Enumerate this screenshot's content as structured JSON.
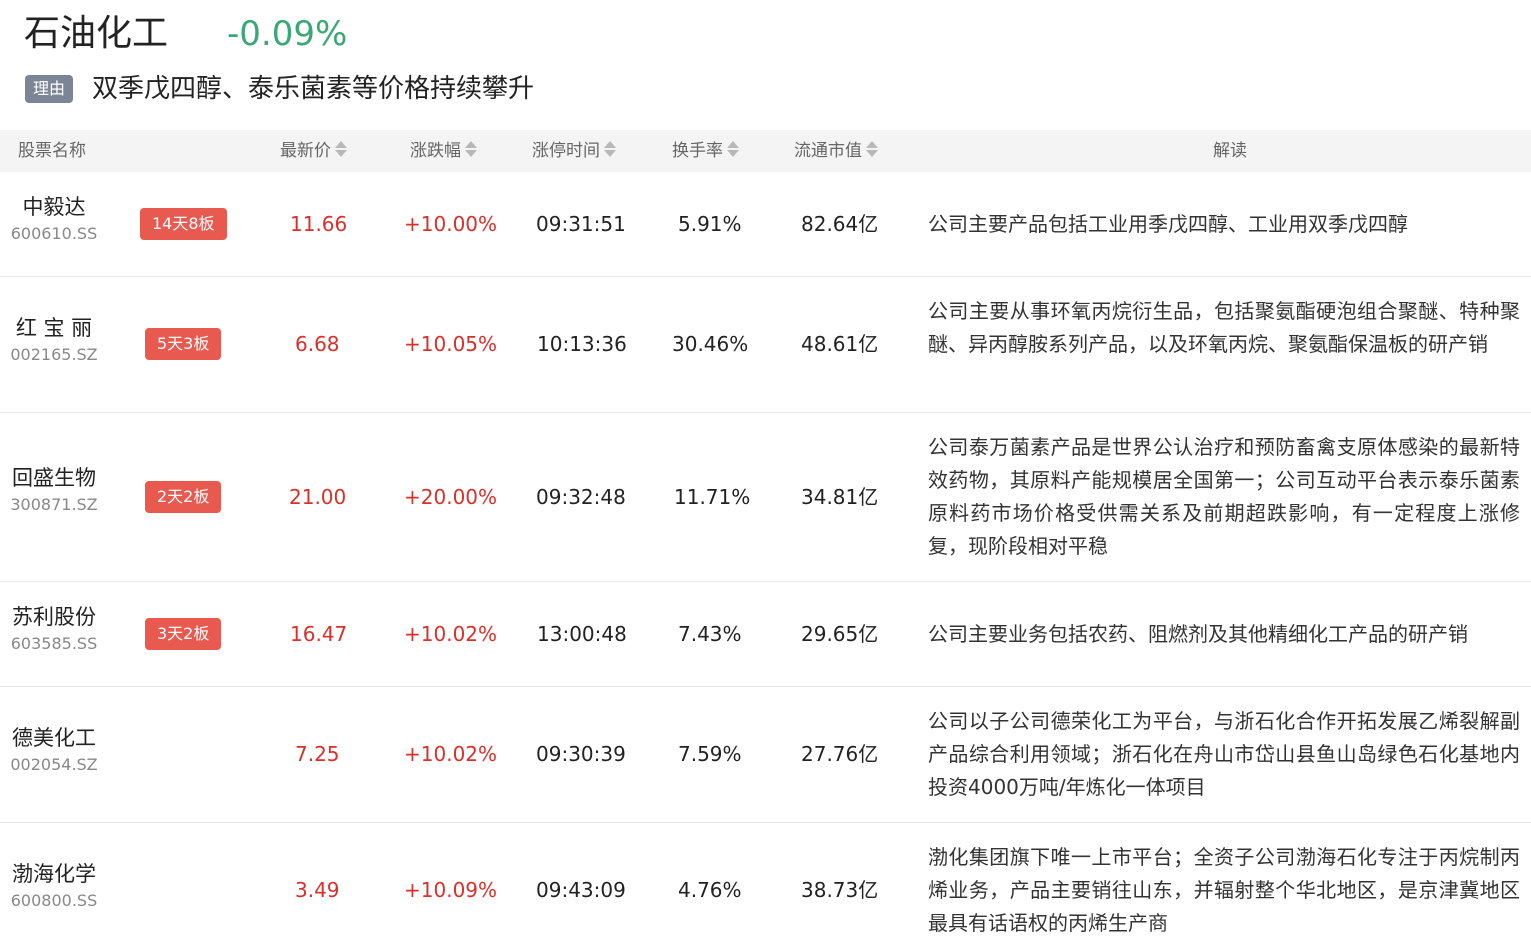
{
  "sector": {
    "name": "石油化工",
    "change": "-0.09%",
    "reason_label": "理由",
    "reason": "双季戊四醇、泰乐菌素等价格持续攀升"
  },
  "columns": {
    "name": "股票名称",
    "price": "最新价",
    "change": "涨跌幅",
    "limit_time": "涨停时间",
    "turnover": "换手率",
    "market_cap": "流通市值",
    "analysis": "解读"
  },
  "rows": [
    {
      "name": "中毅达",
      "code": "600610.SS",
      "tag": "14天8板",
      "price": "11.66",
      "change": "+10.00%",
      "time": "09:31:51",
      "turnover": "5.91%",
      "cap": "82.64亿",
      "desc": "公司主要产品包括工业用季戊四醇、工业用双季戊四醇"
    },
    {
      "name": "红 宝 丽",
      "code": "002165.SZ",
      "tag": "5天3板",
      "price": "6.68",
      "change": "+10.05%",
      "time": "10:13:36",
      "turnover": "30.46%",
      "cap": "48.61亿",
      "desc": "公司主要从事环氧丙烷衍生品，包括聚氨酯硬泡组合聚醚、特种聚醚、异丙醇胺系列产品，以及环氧丙烷、聚氨酯保温板的研产销"
    },
    {
      "name": "回盛生物",
      "code": "300871.SZ",
      "tag": "2天2板",
      "price": "21.00",
      "change": "+20.00%",
      "time": "09:32:48",
      "turnover": "11.71%",
      "cap": "34.81亿",
      "desc": "公司泰万菌素产品是世界公认治疗和预防畜禽支原体感染的最新特效药物，其原料产能规模居全国第一；公司互动平台表示泰乐菌素原料药市场价格受供需关系及前期超跌影响，有一定程度上涨修复，现阶段相对平稳"
    },
    {
      "name": "苏利股份",
      "code": "603585.SS",
      "tag": "3天2板",
      "price": "16.47",
      "change": "+10.02%",
      "time": "13:00:48",
      "turnover": "7.43%",
      "cap": "29.65亿",
      "desc": "公司主要业务包括农药、阻燃剂及其他精细化工产品的研产销"
    },
    {
      "name": "德美化工",
      "code": "002054.SZ",
      "tag": "",
      "price": "7.25",
      "change": "+10.02%",
      "time": "09:30:39",
      "turnover": "7.59%",
      "cap": "27.76亿",
      "desc": "公司以子公司德荣化工为平台，与浙石化合作开拓发展乙烯裂解副产品综合利用领域；浙石化在舟山市岱山县鱼山岛绿色石化基地内投资4000万吨/年炼化一体项目"
    },
    {
      "name": "渤海化学",
      "code": "600800.SS",
      "tag": "",
      "price": "3.49",
      "change": "+10.09%",
      "time": "09:43:09",
      "turnover": "4.76%",
      "cap": "38.73亿",
      "desc": "渤化集团旗下唯一上市平台；全资子公司渤海石化专注于丙烷制丙烯业务，产品主要销往山东，并辐射整个华北地区，是京津冀地区最具有话语权的丙烯生产商"
    }
  ]
}
